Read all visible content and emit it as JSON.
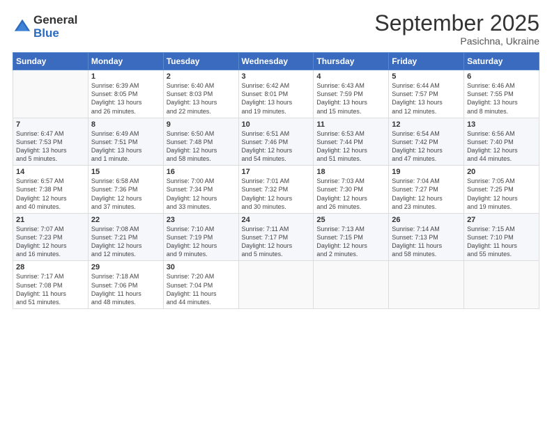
{
  "logo": {
    "general": "General",
    "blue": "Blue"
  },
  "title": "September 2025",
  "location": "Pasichna, Ukraine",
  "days_of_week": [
    "Sunday",
    "Monday",
    "Tuesday",
    "Wednesday",
    "Thursday",
    "Friday",
    "Saturday"
  ],
  "weeks": [
    [
      {
        "day": "",
        "info": ""
      },
      {
        "day": "1",
        "info": "Sunrise: 6:39 AM\nSunset: 8:05 PM\nDaylight: 13 hours\nand 26 minutes."
      },
      {
        "day": "2",
        "info": "Sunrise: 6:40 AM\nSunset: 8:03 PM\nDaylight: 13 hours\nand 22 minutes."
      },
      {
        "day": "3",
        "info": "Sunrise: 6:42 AM\nSunset: 8:01 PM\nDaylight: 13 hours\nand 19 minutes."
      },
      {
        "day": "4",
        "info": "Sunrise: 6:43 AM\nSunset: 7:59 PM\nDaylight: 13 hours\nand 15 minutes."
      },
      {
        "day": "5",
        "info": "Sunrise: 6:44 AM\nSunset: 7:57 PM\nDaylight: 13 hours\nand 12 minutes."
      },
      {
        "day": "6",
        "info": "Sunrise: 6:46 AM\nSunset: 7:55 PM\nDaylight: 13 hours\nand 8 minutes."
      }
    ],
    [
      {
        "day": "7",
        "info": "Sunrise: 6:47 AM\nSunset: 7:53 PM\nDaylight: 13 hours\nand 5 minutes."
      },
      {
        "day": "8",
        "info": "Sunrise: 6:49 AM\nSunset: 7:51 PM\nDaylight: 13 hours\nand 1 minute."
      },
      {
        "day": "9",
        "info": "Sunrise: 6:50 AM\nSunset: 7:48 PM\nDaylight: 12 hours\nand 58 minutes."
      },
      {
        "day": "10",
        "info": "Sunrise: 6:51 AM\nSunset: 7:46 PM\nDaylight: 12 hours\nand 54 minutes."
      },
      {
        "day": "11",
        "info": "Sunrise: 6:53 AM\nSunset: 7:44 PM\nDaylight: 12 hours\nand 51 minutes."
      },
      {
        "day": "12",
        "info": "Sunrise: 6:54 AM\nSunset: 7:42 PM\nDaylight: 12 hours\nand 47 minutes."
      },
      {
        "day": "13",
        "info": "Sunrise: 6:56 AM\nSunset: 7:40 PM\nDaylight: 12 hours\nand 44 minutes."
      }
    ],
    [
      {
        "day": "14",
        "info": "Sunrise: 6:57 AM\nSunset: 7:38 PM\nDaylight: 12 hours\nand 40 minutes."
      },
      {
        "day": "15",
        "info": "Sunrise: 6:58 AM\nSunset: 7:36 PM\nDaylight: 12 hours\nand 37 minutes."
      },
      {
        "day": "16",
        "info": "Sunrise: 7:00 AM\nSunset: 7:34 PM\nDaylight: 12 hours\nand 33 minutes."
      },
      {
        "day": "17",
        "info": "Sunrise: 7:01 AM\nSunset: 7:32 PM\nDaylight: 12 hours\nand 30 minutes."
      },
      {
        "day": "18",
        "info": "Sunrise: 7:03 AM\nSunset: 7:30 PM\nDaylight: 12 hours\nand 26 minutes."
      },
      {
        "day": "19",
        "info": "Sunrise: 7:04 AM\nSunset: 7:27 PM\nDaylight: 12 hours\nand 23 minutes."
      },
      {
        "day": "20",
        "info": "Sunrise: 7:05 AM\nSunset: 7:25 PM\nDaylight: 12 hours\nand 19 minutes."
      }
    ],
    [
      {
        "day": "21",
        "info": "Sunrise: 7:07 AM\nSunset: 7:23 PM\nDaylight: 12 hours\nand 16 minutes."
      },
      {
        "day": "22",
        "info": "Sunrise: 7:08 AM\nSunset: 7:21 PM\nDaylight: 12 hours\nand 12 minutes."
      },
      {
        "day": "23",
        "info": "Sunrise: 7:10 AM\nSunset: 7:19 PM\nDaylight: 12 hours\nand 9 minutes."
      },
      {
        "day": "24",
        "info": "Sunrise: 7:11 AM\nSunset: 7:17 PM\nDaylight: 12 hours\nand 5 minutes."
      },
      {
        "day": "25",
        "info": "Sunrise: 7:13 AM\nSunset: 7:15 PM\nDaylight: 12 hours\nand 2 minutes."
      },
      {
        "day": "26",
        "info": "Sunrise: 7:14 AM\nSunset: 7:13 PM\nDaylight: 11 hours\nand 58 minutes."
      },
      {
        "day": "27",
        "info": "Sunrise: 7:15 AM\nSunset: 7:10 PM\nDaylight: 11 hours\nand 55 minutes."
      }
    ],
    [
      {
        "day": "28",
        "info": "Sunrise: 7:17 AM\nSunset: 7:08 PM\nDaylight: 11 hours\nand 51 minutes."
      },
      {
        "day": "29",
        "info": "Sunrise: 7:18 AM\nSunset: 7:06 PM\nDaylight: 11 hours\nand 48 minutes."
      },
      {
        "day": "30",
        "info": "Sunrise: 7:20 AM\nSunset: 7:04 PM\nDaylight: 11 hours\nand 44 minutes."
      },
      {
        "day": "",
        "info": ""
      },
      {
        "day": "",
        "info": ""
      },
      {
        "day": "",
        "info": ""
      },
      {
        "day": "",
        "info": ""
      }
    ]
  ]
}
